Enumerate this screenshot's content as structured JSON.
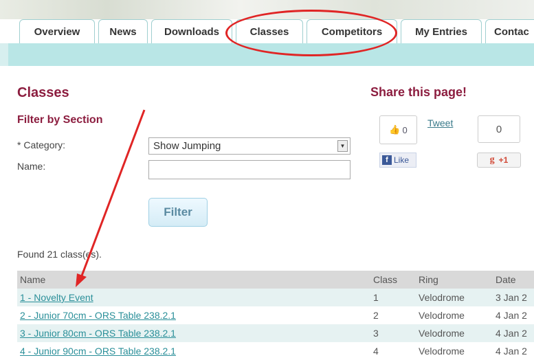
{
  "nav": {
    "tabs": [
      {
        "label": "Overview"
      },
      {
        "label": "News"
      },
      {
        "label": "Downloads"
      },
      {
        "label": "Classes"
      },
      {
        "label": "Competitors"
      },
      {
        "label": "My Entries"
      },
      {
        "label": "Contac"
      }
    ]
  },
  "page": {
    "title": "Classes",
    "filter_title": "Filter by Section"
  },
  "filter": {
    "category_label": "* Category:",
    "category_value": "Show Jumping",
    "name_label": "Name:",
    "name_value": "",
    "button_label": "Filter"
  },
  "share": {
    "title": "Share this page!",
    "fb_count": "0",
    "fb_like_label": "Like",
    "tweet_label": "Tweet",
    "gplus_count": "0",
    "gplus_label": "+1"
  },
  "results": {
    "found_text": "Found 21 class(es).",
    "headers": {
      "name": "Name",
      "class": "Class",
      "ring": "Ring",
      "date": "Date"
    },
    "rows": [
      {
        "name": "1 - Novelty Event",
        "class": "1",
        "ring": "Velodrome",
        "date": "3 Jan 2"
      },
      {
        "name": "2 - Junior 70cm - ORS Table 238.2.1",
        "class": "2",
        "ring": "Velodrome",
        "date": "4 Jan 2"
      },
      {
        "name": "3 - Junior 80cm - ORS Table 238.2.1",
        "class": "3",
        "ring": "Velodrome",
        "date": "4 Jan 2"
      },
      {
        "name": "4 - Junior 90cm - ORS Table 238.2.1",
        "class": "4",
        "ring": "Velodrome",
        "date": "4 Jan 2"
      }
    ]
  },
  "colors": {
    "accent_maroon": "#8c1d3f",
    "tab_stripe": "#b9e6e6",
    "link_teal": "#2a8f99",
    "annotation_red": "#e02525"
  }
}
